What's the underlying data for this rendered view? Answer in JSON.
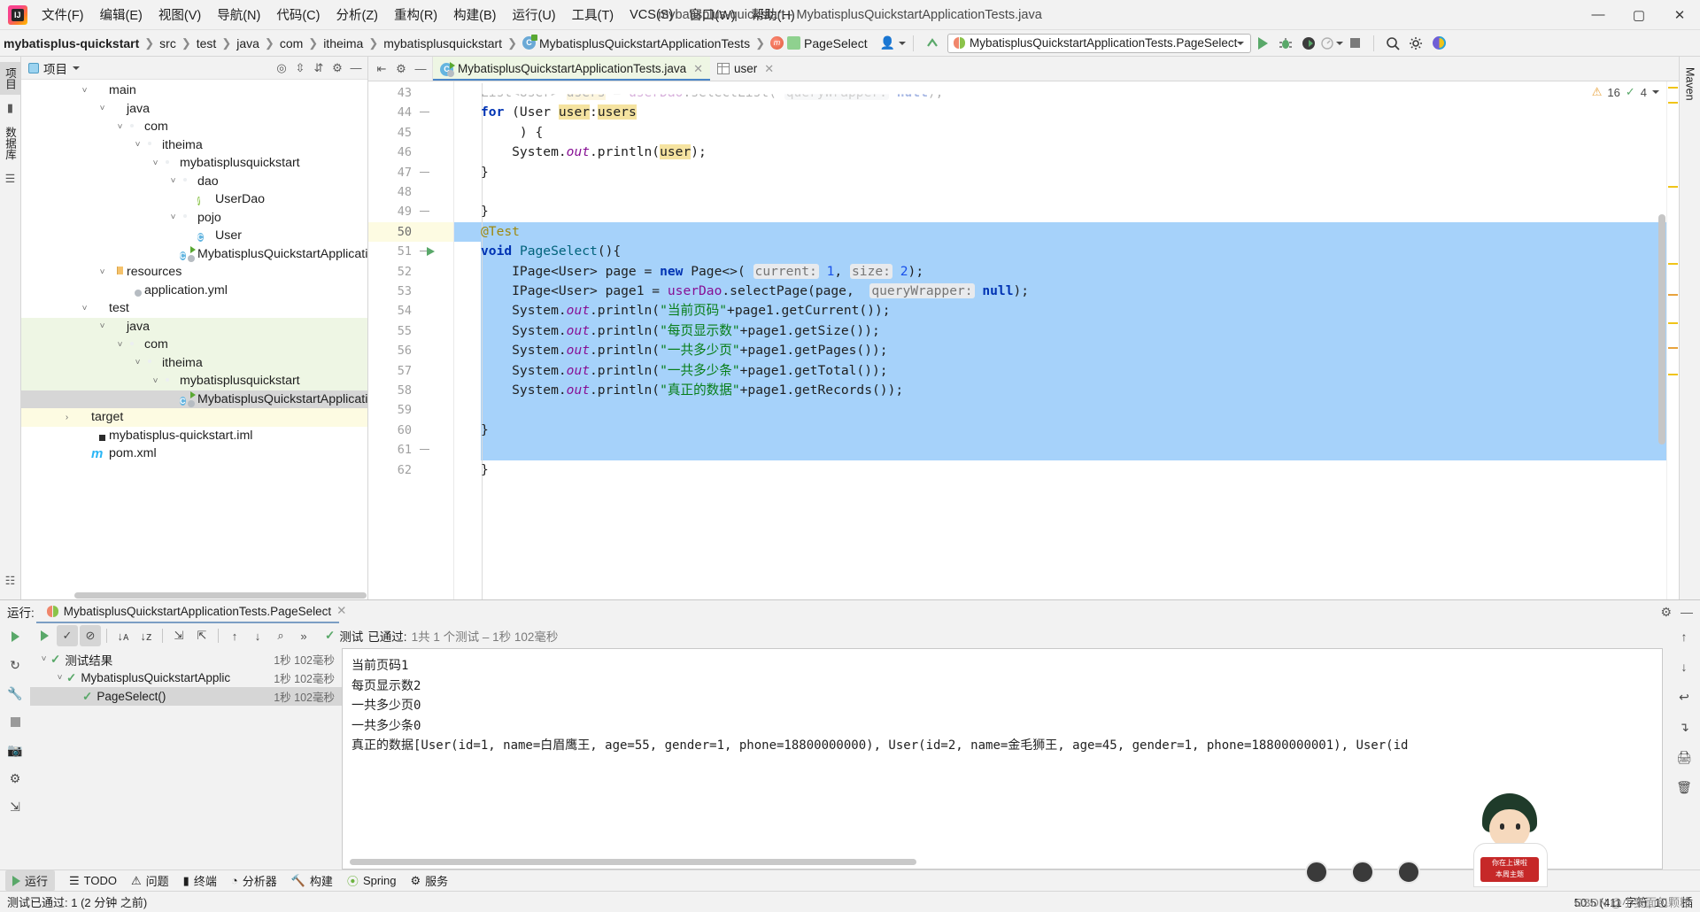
{
  "window": {
    "title": "mybatisplus-quickstart - MybatisplusQuickstartApplicationTests.java",
    "minimize": "—",
    "maximize": "▢",
    "close": "✕"
  },
  "menu": [
    {
      "label": "文件(F)"
    },
    {
      "label": "编辑(E)"
    },
    {
      "label": "视图(V)"
    },
    {
      "label": "导航(N)"
    },
    {
      "label": "代码(C)"
    },
    {
      "label": "分析(Z)"
    },
    {
      "label": "重构(R)"
    },
    {
      "label": "构建(B)"
    },
    {
      "label": "运行(U)"
    },
    {
      "label": "工具(T)"
    },
    {
      "label": "VCS(S)"
    },
    {
      "label": "窗口(W)"
    },
    {
      "label": "帮助(H)"
    }
  ],
  "breadcrumbs": [
    {
      "label": "mybatisplus-quickstart",
      "icon": "none",
      "bold": true
    },
    {
      "label": "src",
      "icon": "none",
      "bold": false
    },
    {
      "label": "test",
      "icon": "none",
      "bold": false
    },
    {
      "label": "java",
      "icon": "none",
      "bold": false
    },
    {
      "label": "com",
      "icon": "none",
      "bold": false
    },
    {
      "label": "itheima",
      "icon": "none",
      "bold": false
    },
    {
      "label": "mybatisplusquickstart",
      "icon": "none",
      "bold": false
    },
    {
      "label": "MybatisplusQuickstartApplicationTests",
      "icon": "class-icon",
      "bold": false
    },
    {
      "label": "PageSelect",
      "icon": "method-icon",
      "bold": false
    }
  ],
  "toolbar": {
    "run_configuration": "MybatisplusQuickstartApplicationTests.PageSelect",
    "run_tooltip": "运行",
    "debug_tooltip": "调试",
    "coverage_tooltip": "覆盖率",
    "profile_tooltip": "性能分析",
    "stop_tooltip": "停止",
    "search_tooltip": "搜索",
    "settings_tooltip": "设置"
  },
  "left_strip": {
    "tabs": [
      "项目",
      "数据库"
    ]
  },
  "right_strip": {
    "tabs": [
      "Maven"
    ]
  },
  "project_panel": {
    "title": "项目",
    "tree": [
      {
        "label": "main",
        "depth": 3,
        "arrow": "v",
        "icon": "folder",
        "state": "normal"
      },
      {
        "label": "java",
        "depth": 4,
        "arrow": "v",
        "icon": "folder-blue",
        "state": "normal"
      },
      {
        "label": "com",
        "depth": 5,
        "arrow": "v",
        "icon": "package",
        "state": "normal"
      },
      {
        "label": "itheima",
        "depth": 6,
        "arrow": "v",
        "icon": "package",
        "state": "normal"
      },
      {
        "label": "mybatisplusquickstart",
        "depth": 7,
        "arrow": "v",
        "icon": "package",
        "state": "normal"
      },
      {
        "label": "dao",
        "depth": 8,
        "arrow": "v",
        "icon": "package",
        "state": "normal"
      },
      {
        "label": "UserDao",
        "depth": 9,
        "arrow": "",
        "icon": "interface",
        "state": "normal"
      },
      {
        "label": "pojo",
        "depth": 8,
        "arrow": "v",
        "icon": "package",
        "state": "normal"
      },
      {
        "label": "User",
        "depth": 9,
        "arrow": "",
        "icon": "class",
        "state": "normal"
      },
      {
        "label": "MybatisplusQuickstartApplication",
        "depth": 8,
        "arrow": "",
        "icon": "spring-class",
        "state": "normal"
      },
      {
        "label": "resources",
        "depth": 4,
        "arrow": "v",
        "icon": "folder-resources",
        "state": "normal"
      },
      {
        "label": "application.yml",
        "depth": 5,
        "arrow": "",
        "icon": "yaml",
        "state": "normal"
      },
      {
        "label": "test",
        "depth": 3,
        "arrow": "v",
        "icon": "folder",
        "state": "normal"
      },
      {
        "label": "java",
        "depth": 4,
        "arrow": "v",
        "icon": "folder-green",
        "state": "test-source"
      },
      {
        "label": "com",
        "depth": 5,
        "arrow": "v",
        "icon": "package",
        "state": "test-source"
      },
      {
        "label": "itheima",
        "depth": 6,
        "arrow": "v",
        "icon": "package",
        "state": "test-source"
      },
      {
        "label": "mybatisplusquickstart",
        "depth": 7,
        "arrow": "v",
        "icon": "package",
        "state": "test-source"
      },
      {
        "label": "MybatisplusQuickstartApplicationTests",
        "depth": 8,
        "arrow": "",
        "icon": "spring-class",
        "state": "selected"
      },
      {
        "label": "target",
        "depth": 2,
        "arrow": ">",
        "icon": "folder-orange",
        "state": "highlight"
      },
      {
        "label": "mybatisplus-quickstart.iml",
        "depth": 3,
        "arrow": "",
        "icon": "iml",
        "state": "normal"
      },
      {
        "label": "pom.xml",
        "depth": 3,
        "arrow": "",
        "icon": "maven",
        "state": "normal"
      }
    ]
  },
  "editor": {
    "tabs": [
      {
        "label": "MybatisplusQuickstartApplicationTests.java",
        "icon": "spring-class",
        "active": true
      },
      {
        "label": "user",
        "icon": "table",
        "active": false
      }
    ],
    "inspections": {
      "warnings": "16",
      "checks": "4"
    },
    "lines": [
      {
        "num": "43",
        "text": "List<User> users = userDao.selectList( queryWrapper: null);",
        "partial": true
      },
      {
        "num": "44",
        "text": "for (User user:users"
      },
      {
        "num": "45",
        "text": "     ) {"
      },
      {
        "num": "46",
        "text": "    System.out.println(user);"
      },
      {
        "num": "47",
        "text": "}"
      },
      {
        "num": "48",
        "text": ""
      },
      {
        "num": "49",
        "text": "}"
      },
      {
        "num": "50",
        "text": "@Test"
      },
      {
        "num": "51",
        "text": "void PageSelect(){"
      },
      {
        "num": "52",
        "text": "    IPage<User> page = new Page<>( current: 1, size: 2);"
      },
      {
        "num": "53",
        "text": "    IPage<User> page1 = userDao.selectPage(page,  queryWrapper: null);"
      },
      {
        "num": "54",
        "text": "    System.out.println(\"当前页码\"+page1.getCurrent());"
      },
      {
        "num": "55",
        "text": "    System.out.println(\"每页显示数\"+page1.getSize());"
      },
      {
        "num": "56",
        "text": "    System.out.println(\"一共多少页\"+page1.getPages());"
      },
      {
        "num": "57",
        "text": "    System.out.println(\"一共多少条\"+page1.getTotal());"
      },
      {
        "num": "58",
        "text": "    System.out.println(\"真正的数据\"+page1.getRecords());"
      },
      {
        "num": "59",
        "text": ""
      },
      {
        "num": "60",
        "text": "}"
      },
      {
        "num": "61",
        "text": ""
      },
      {
        "num": "62",
        "text": "}"
      }
    ]
  },
  "run_panel": {
    "label": "运行:",
    "tab_title": "MybatisplusQuickstartApplicationTests.PageSelect",
    "close": "✕",
    "status_prefix": "测试",
    "status_passed": "已通过:",
    "status_detail": "1共 1 个测试 – 1秒 102毫秒",
    "toolbar_buttons": [
      {
        "name": "rerun-button",
        "glyph": "▶"
      },
      {
        "name": "show-passed-toggle",
        "glyph": "✓"
      },
      {
        "name": "show-ignored-toggle",
        "glyph": "⊘"
      },
      {
        "name": "sort-alphabetically-button",
        "glyph": "↓ᴀ"
      },
      {
        "name": "sort-by-duration-button",
        "glyph": "↓ᴢ"
      },
      {
        "name": "expand-all-button",
        "glyph": "⇲"
      },
      {
        "name": "collapse-all-button",
        "glyph": "⇱"
      },
      {
        "name": "prev-failed-button",
        "glyph": "↑"
      },
      {
        "name": "next-failed-button",
        "glyph": "↓"
      },
      {
        "name": "search-history-button",
        "glyph": "⌕"
      },
      {
        "name": "more-button",
        "glyph": "»"
      }
    ],
    "tests": [
      {
        "label": "测试结果",
        "duration": "1秒 102毫秒",
        "depth": 0,
        "arrow": "v",
        "selected": false
      },
      {
        "label": "MybatisplusQuickstartApplic",
        "duration": "1秒 102毫秒",
        "depth": 1,
        "arrow": "v",
        "selected": false
      },
      {
        "label": "PageSelect()",
        "duration": "1秒 102毫秒",
        "depth": 2,
        "arrow": "",
        "selected": true
      }
    ],
    "console_lines": [
      "当前页码1",
      "每页显示数2",
      "一共多少页0",
      "一共多少条0",
      "真正的数据[User(id=1, name=白眉鹰王, age=55, gender=1, phone=18800000000), User(id=2, name=金毛狮王, age=45, gender=1, phone=18800000001), User(id"
    ]
  },
  "bottom_tabs": [
    {
      "label": "运行",
      "icon": "run-icon",
      "active": true
    },
    {
      "label": "TODO",
      "icon": "todo-icon",
      "active": false
    },
    {
      "label": "问题",
      "icon": "problems-icon",
      "active": false
    },
    {
      "label": "终端",
      "icon": "terminal-icon",
      "active": false
    },
    {
      "label": "分析器",
      "icon": "profiler-icon",
      "active": false
    },
    {
      "label": "构建",
      "icon": "build-icon",
      "active": false
    },
    {
      "label": "Spring",
      "icon": "spring-icon",
      "active": false
    },
    {
      "label": "服务",
      "icon": "services-icon",
      "active": false
    }
  ],
  "status_bar": {
    "message": "测试已通过: 1 (2 分钟 之前)",
    "caret": "50:5 (411 字符, 10",
    "trailing": "插"
  },
  "watermark": "CSDN @小麦面包颗粒",
  "colors": {
    "accent_blue": "#4a86c8",
    "selection_blue": "#a6d2fa",
    "test_source_green": "#eef6e4",
    "highlight_yellow": "#fdfbe2",
    "run_green": "#59a869",
    "string_green": "#067d17",
    "keyword_blue": "#0033b3",
    "annotation_gold": "#9e880d"
  }
}
